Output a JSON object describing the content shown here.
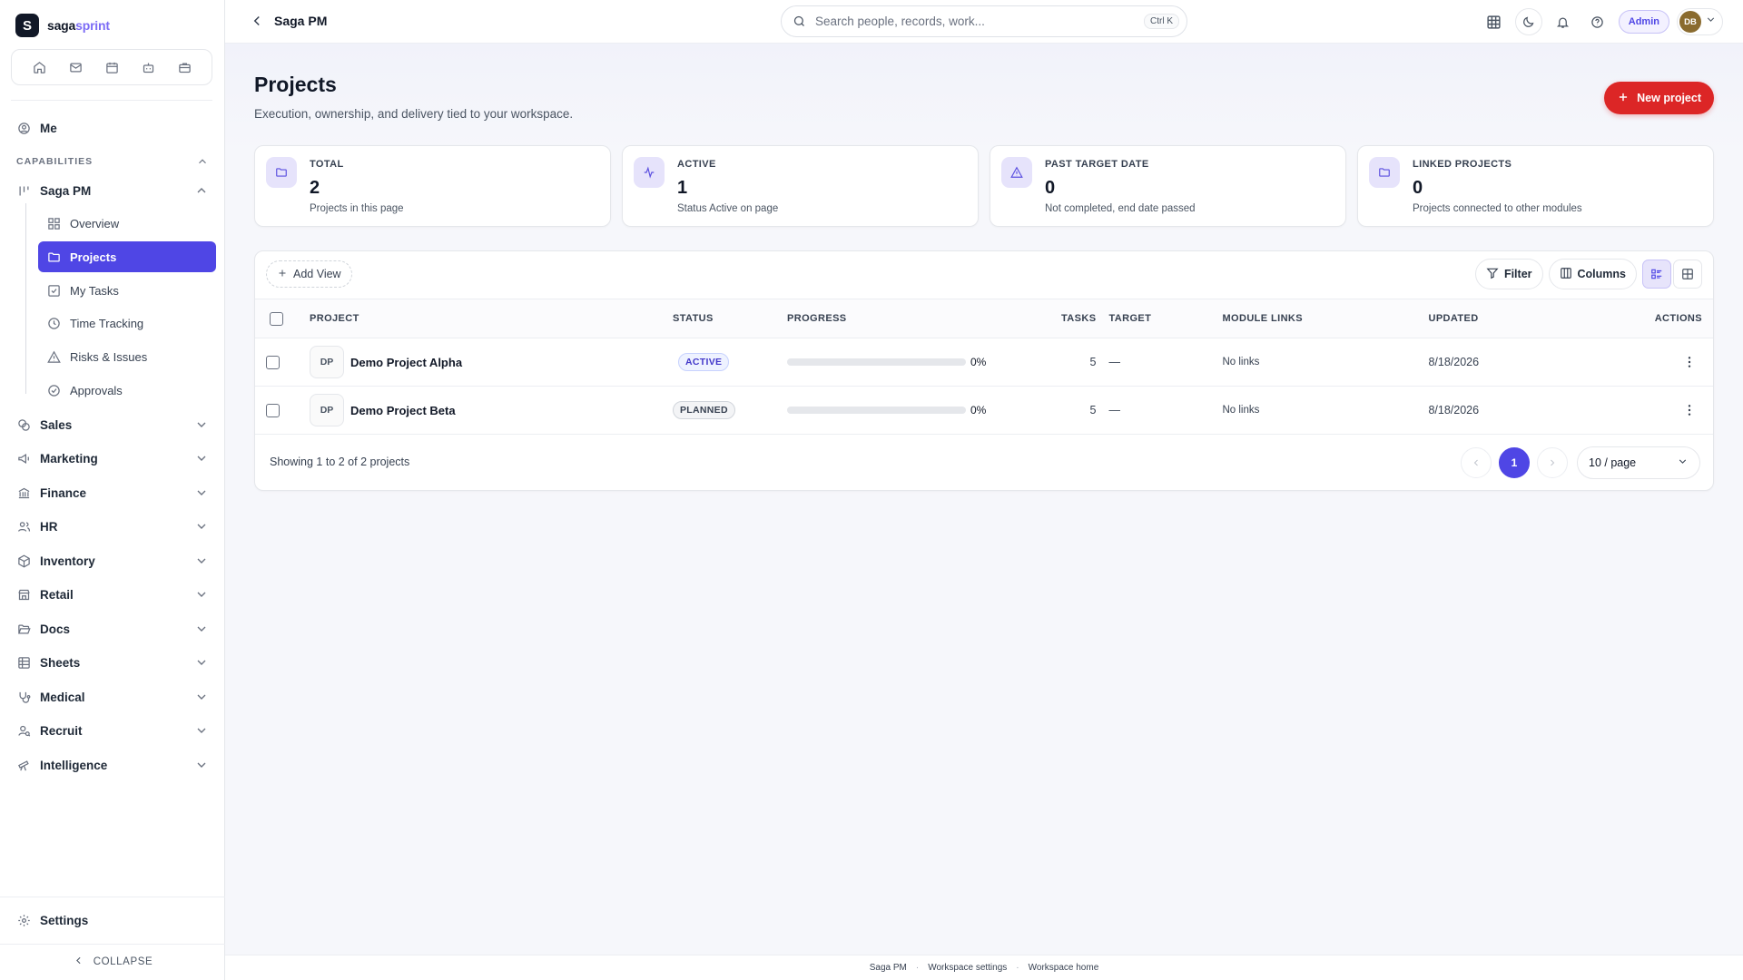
{
  "brand": {
    "logo_letter": "S",
    "name_part1": "saga",
    "name_part2": "sprint",
    "accent": "#7c6cf5"
  },
  "quick_icons": [
    "home-icon",
    "mail-icon",
    "calendar-icon",
    "bot-icon",
    "briefcase-icon"
  ],
  "sidebar": {
    "me": "Me",
    "section_label": "CAPABILITIES",
    "saga_pm": "Saga PM",
    "sub_items": [
      {
        "label": "Overview",
        "icon": "grid-icon"
      },
      {
        "label": "Projects",
        "icon": "folder-icon",
        "active": true
      },
      {
        "label": "My Tasks",
        "icon": "checkbox-icon"
      },
      {
        "label": "Time Tracking",
        "icon": "clock-icon"
      },
      {
        "label": "Risks & Issues",
        "icon": "warning-icon"
      },
      {
        "label": "Approvals",
        "icon": "check-circle-icon"
      }
    ],
    "modules": [
      {
        "label": "Sales",
        "icon": "coins-icon"
      },
      {
        "label": "Marketing",
        "icon": "megaphone-icon"
      },
      {
        "label": "Finance",
        "icon": "bank-icon"
      },
      {
        "label": "HR",
        "icon": "users-icon"
      },
      {
        "label": "Inventory",
        "icon": "box-icon"
      },
      {
        "label": "Retail",
        "icon": "store-icon"
      },
      {
        "label": "Docs",
        "icon": "folder-open-icon"
      },
      {
        "label": "Sheets",
        "icon": "table-icon"
      },
      {
        "label": "Medical",
        "icon": "stethoscope-icon"
      },
      {
        "label": "Recruit",
        "icon": "user-search-icon"
      },
      {
        "label": "Intelligence",
        "icon": "telescope-icon"
      }
    ],
    "settings": "Settings",
    "collapse": "COLLAPSE"
  },
  "topbar": {
    "breadcrumb": "Saga PM",
    "search_placeholder": "Search people, records, work...",
    "search_shortcut": "Ctrl K",
    "admin": "Admin",
    "avatar_initials": "DB"
  },
  "page": {
    "title": "Projects",
    "subtitle": "Execution, ownership, and delivery tied to your workspace.",
    "new_button": "New project"
  },
  "stats": [
    {
      "label": "TOTAL",
      "value": "2",
      "desc": "Projects in this page",
      "icon": "folder-icon"
    },
    {
      "label": "ACTIVE",
      "value": "1",
      "desc": "Status Active on page",
      "icon": "activity-icon"
    },
    {
      "label": "PAST TARGET DATE",
      "value": "0",
      "desc": "Not completed, end date passed",
      "icon": "warning-icon"
    },
    {
      "label": "LINKED PROJECTS",
      "value": "0",
      "desc": "Projects connected to other modules",
      "icon": "folder-icon"
    }
  ],
  "table": {
    "add_view": "Add View",
    "filter": "Filter",
    "columns_label": "Columns",
    "headers": {
      "project": "PROJECT",
      "status": "STATUS",
      "progress": "PROGRESS",
      "tasks": "TASKS",
      "target": "TARGET",
      "module_links": "MODULE LINKS",
      "updated": "UPDATED",
      "actions": "ACTIONS"
    },
    "rows": [
      {
        "initials": "DP",
        "name": "Demo Project Alpha",
        "status": "ACTIVE",
        "status_kind": "active",
        "progress": 0,
        "progress_label": "0%",
        "tasks": "5",
        "target": "—",
        "module_links": "No links",
        "updated": "8/18/2026"
      },
      {
        "initials": "DP",
        "name": "Demo Project Beta",
        "status": "PLANNED",
        "status_kind": "planned",
        "progress": 0,
        "progress_label": "0%",
        "tasks": "5",
        "target": "—",
        "module_links": "No links",
        "updated": "8/18/2026"
      }
    ],
    "showing": "Showing 1 to 2 of 2 projects",
    "current_page": "1",
    "per_page": "10 / page"
  },
  "footer": {
    "link1": "Saga PM",
    "link2": "Workspace settings",
    "link3": "Workspace home"
  },
  "colors": {
    "primary": "#4f46e5",
    "danger": "#dc2626"
  }
}
